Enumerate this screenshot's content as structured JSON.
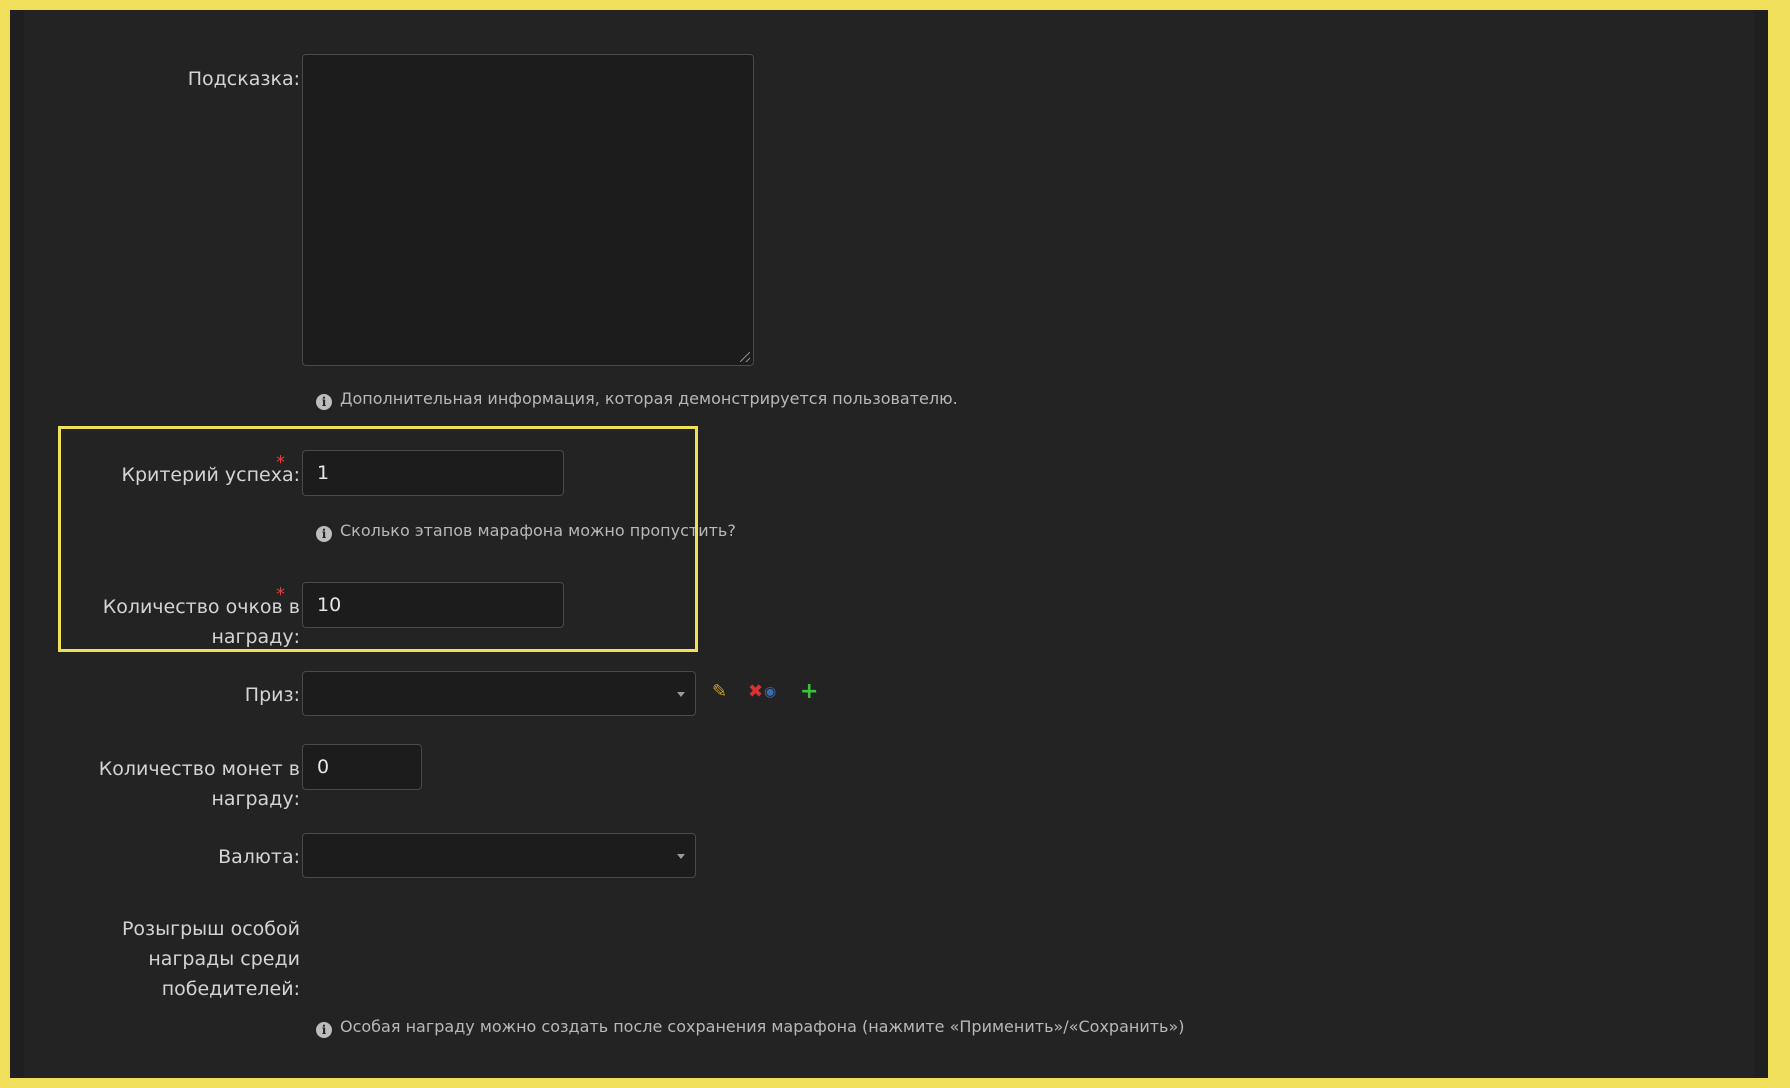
{
  "form": {
    "hint": {
      "label": "Подсказка:",
      "value": "",
      "help": "Дополнительная информация, которая демонстрируется пользователю."
    },
    "success_criterion": {
      "label": "Критерий успеха:",
      "required_mark": "*",
      "value": "1",
      "help": "Сколько этапов марафона можно пропустить?"
    },
    "points_reward": {
      "label_line1": "Количество очков в",
      "label_line2": "награду:",
      "required_mark": "*",
      "value": "10"
    },
    "prize": {
      "label": "Приз:",
      "selected": "",
      "actions": {
        "edit_icon": "pencil-icon",
        "remove_icon": "close-icon",
        "view_icon": "eye-icon",
        "add_icon": "plus-icon"
      }
    },
    "coins_reward": {
      "label_line1": "Количество монет в",
      "label_line2": "награду:",
      "value": "0"
    },
    "currency": {
      "label": "Валюта:",
      "selected": ""
    },
    "special_draw": {
      "label_line1": "Розыгрыш особой",
      "label_line2": "награды среди",
      "label_line3": "победителей:",
      "help": "Особая награду можно создать после сохранения марафона (нажмите «Применить»/«Сохранить»)"
    }
  },
  "colors": {
    "highlight": "#f0df5a",
    "required": "#e04040",
    "edit_icon": "#c8a020",
    "remove_icon": "#e03030",
    "view_icon": "#3a6ab0",
    "add_icon": "#3cc03c"
  },
  "icons": {
    "info": "info-circle-icon",
    "dropdown": "chevron-down-icon"
  }
}
